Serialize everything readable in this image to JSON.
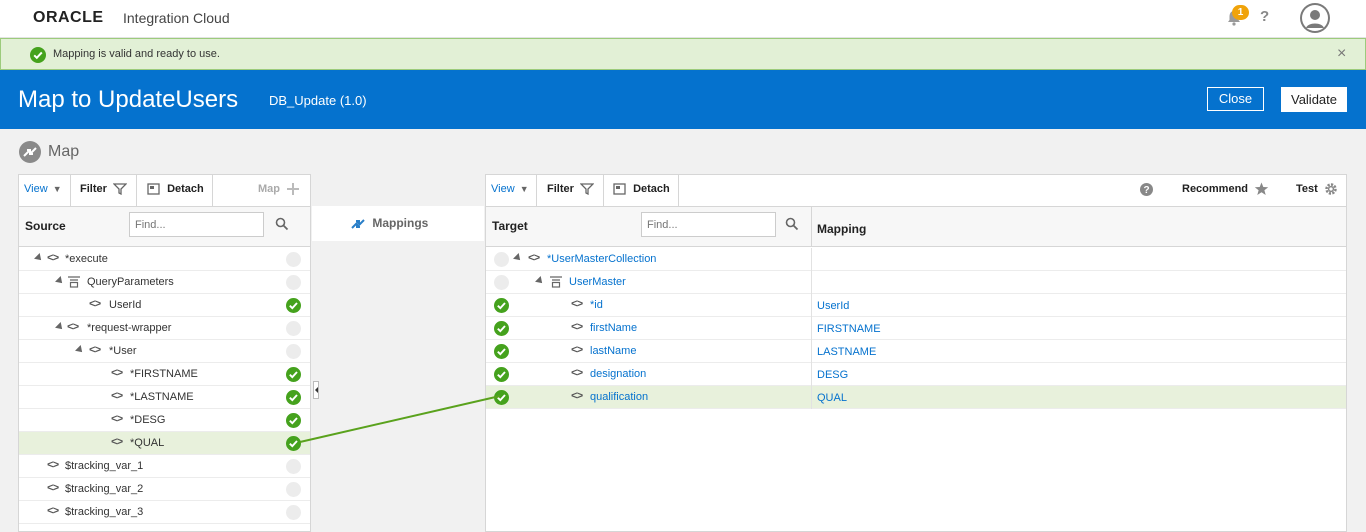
{
  "topbar": {
    "brand_oracle": "ORACLE",
    "brand_product": "Integration Cloud",
    "notification_count": "1",
    "help": "?"
  },
  "banner": {
    "message": "Mapping is valid and ready to use.",
    "close": "×"
  },
  "header": {
    "title": "Map to UpdateUsers",
    "subtitle": "DB_Update (1.0)",
    "close_label": "Close",
    "validate_label": "Validate"
  },
  "map_title": "Map",
  "source": {
    "toolbar": {
      "view": "View",
      "filter": "Filter",
      "detach": "Detach",
      "map": "Map"
    },
    "column_label": "Source",
    "find_placeholder": "Find...",
    "rows": [
      {
        "label": "*execute",
        "status": "empty"
      },
      {
        "label": "QueryParameters",
        "status": "empty"
      },
      {
        "label": "UserId",
        "status": "ok"
      },
      {
        "label": "*request-wrapper",
        "status": "empty"
      },
      {
        "label": "*User",
        "status": "empty"
      },
      {
        "label": "*FIRSTNAME",
        "status": "ok"
      },
      {
        "label": "*LASTNAME",
        "status": "ok"
      },
      {
        "label": "*DESG",
        "status": "ok"
      },
      {
        "label": "*QUAL",
        "status": "ok"
      },
      {
        "label": "$tracking_var_1",
        "status": "empty"
      },
      {
        "label": "$tracking_var_2",
        "status": "empty"
      },
      {
        "label": "$tracking_var_3",
        "status": "empty"
      }
    ]
  },
  "middle": {
    "mappings_label": "Mappings"
  },
  "target": {
    "toolbar": {
      "view": "View",
      "filter": "Filter",
      "detach": "Detach",
      "help": "?",
      "recommend": "Recommend",
      "test": "Test"
    },
    "column_label": "Target",
    "find_placeholder": "Find...",
    "mapping_label": "Mapping",
    "rows": [
      {
        "label": "*UserMasterCollection",
        "mapping": "",
        "status": "empty"
      },
      {
        "label": "UserMaster",
        "mapping": "",
        "status": "empty"
      },
      {
        "label": "*id",
        "mapping": "UserId",
        "status": "ok"
      },
      {
        "label": "firstName",
        "mapping": "FIRSTNAME",
        "status": "ok"
      },
      {
        "label": "lastName",
        "mapping": "LASTNAME",
        "status": "ok"
      },
      {
        "label": "designation",
        "mapping": "DESG",
        "status": "ok"
      },
      {
        "label": "qualification",
        "mapping": "QUAL",
        "status": "ok"
      }
    ]
  },
  "colors": {
    "accent": "#0572ce",
    "success": "#45a21d",
    "banner_bg": "#e2f0d6",
    "link_line": "#5aa21d"
  }
}
